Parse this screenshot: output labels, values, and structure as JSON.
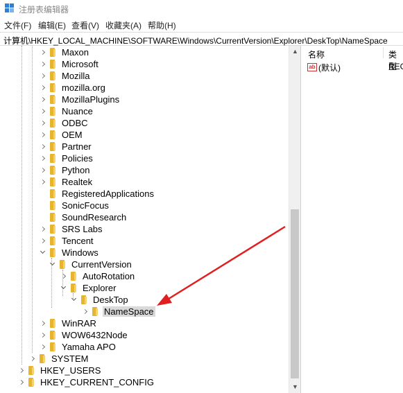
{
  "window": {
    "title": "注册表编辑器"
  },
  "menu": [
    {
      "label": "文件(F)"
    },
    {
      "label": "编辑(E)"
    },
    {
      "label": "查看(V)"
    },
    {
      "label": "收藏夹(A)"
    },
    {
      "label": "帮助(H)"
    }
  ],
  "address": {
    "path": "计算机\\HKEY_LOCAL_MACHINE\\SOFTWARE\\Windows\\CurrentVersion\\Explorer\\DeskTop\\NameSpace"
  },
  "tree": [
    {
      "label": "Maxon",
      "state": "collapsed"
    },
    {
      "label": "Microsoft",
      "state": "collapsed"
    },
    {
      "label": "Mozilla",
      "state": "collapsed"
    },
    {
      "label": "mozilla.org",
      "state": "collapsed"
    },
    {
      "label": "MozillaPlugins",
      "state": "collapsed"
    },
    {
      "label": "Nuance",
      "state": "collapsed"
    },
    {
      "label": "ODBC",
      "state": "collapsed"
    },
    {
      "label": "OEM",
      "state": "collapsed"
    },
    {
      "label": "Partner",
      "state": "collapsed"
    },
    {
      "label": "Policies",
      "state": "collapsed"
    },
    {
      "label": "Python",
      "state": "collapsed"
    },
    {
      "label": "Realtek",
      "state": "collapsed"
    },
    {
      "label": "RegisteredApplications",
      "state": "none"
    },
    {
      "label": "SonicFocus",
      "state": "none"
    },
    {
      "label": "SoundResearch",
      "state": "none"
    },
    {
      "label": "SRS Labs",
      "state": "collapsed"
    },
    {
      "label": "Tencent",
      "state": "collapsed"
    },
    {
      "label": "Windows",
      "state": "expanded"
    },
    {
      "label": "CurrentVersion",
      "state": "expanded"
    },
    {
      "label": "AutoRotation",
      "state": "collapsed"
    },
    {
      "label": "Explorer",
      "state": "expanded"
    },
    {
      "label": "DeskTop",
      "state": "expanded"
    },
    {
      "label": "NameSpace",
      "state": "collapsed",
      "selected": true
    },
    {
      "label": "WinRAR",
      "state": "collapsed"
    },
    {
      "label": "WOW6432Node",
      "state": "collapsed"
    },
    {
      "label": "Yamaha APO",
      "state": "collapsed"
    },
    {
      "label": "SYSTEM",
      "state": "collapsed"
    },
    {
      "label": "HKEY_USERS",
      "state": "collapsed"
    },
    {
      "label": "HKEY_CURRENT_CONFIG",
      "state": "collapsed"
    }
  ],
  "values_pane": {
    "headers": {
      "name": "名称",
      "type": "类型"
    },
    "rows": [
      {
        "icon": "ab",
        "name": "(默认)",
        "type": "REG"
      }
    ]
  },
  "colors": {
    "folder": "#e8b42e",
    "arrow": "#e02020",
    "selection": "#d9d9d9"
  }
}
